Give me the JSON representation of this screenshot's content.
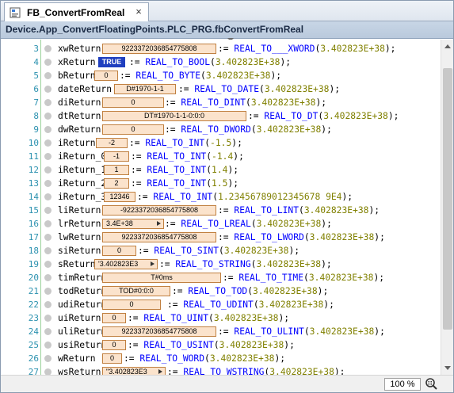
{
  "tab": {
    "label": "FB_ConvertFromReal",
    "close_glyph": "×"
  },
  "header": {
    "title": "Device.App_ConvertFloatingPoints.PLC_PRG.fbConvertFromReal"
  },
  "status": {
    "zoom": "100 %"
  },
  "colors": {
    "keyword": "#0000ff",
    "literal": "#808000",
    "line_number": "#2b91af",
    "monitor_bg": "#fbe3cc",
    "bool_monitor_bg": "#1f3fbf"
  },
  "rows": [
    {
      "line": "3",
      "var": "xwReturn",
      "value": "9223372036854775808",
      "call": "REAL_TO___XWORD",
      "arg": "3.402823E+38"
    },
    {
      "line": "4",
      "var": "xReturn",
      "value": "TRUE",
      "call": "REAL_TO_BOOL",
      "arg": "3.402823E+38"
    },
    {
      "line": "5",
      "var": "bReturn",
      "value": "0",
      "call": "REAL_TO_BYTE",
      "arg": "3.402823E+38"
    },
    {
      "line": "6",
      "var": "dateReturn",
      "value": "D#1970-1-1",
      "call": "REAL_TO_DATE",
      "arg": "3.402823E+38"
    },
    {
      "line": "7",
      "var": "diReturn",
      "value": "0",
      "call": "REAL_TO_DINT",
      "arg": "3.402823E+38"
    },
    {
      "line": "8",
      "var": "dtReturn",
      "value": "DT#1970-1-1-0:0:0",
      "call": "REAL_TO_DT",
      "arg": "3.402823E+38"
    },
    {
      "line": "9",
      "var": "dwReturn",
      "value": "0",
      "call": "REAL_TO_DWORD",
      "arg": "3.402823E+38"
    },
    {
      "line": "10",
      "var": "iReturn",
      "value": "-2",
      "call": "REAL_TO_INT",
      "arg": "-1.5"
    },
    {
      "line": "11",
      "var": "iReturn_0",
      "value": "-1",
      "call": "REAL_TO_INT",
      "arg": "-1.4"
    },
    {
      "line": "12",
      "var": "iReturn_1",
      "value": "1",
      "call": "REAL_TO_INT",
      "arg": "1.4"
    },
    {
      "line": "13",
      "var": "iReturn_2",
      "value": "2",
      "call": "REAL_TO_INT",
      "arg": "1.5"
    },
    {
      "line": "14",
      "var": "iReturn_3",
      "value": "12346",
      "call": "REAL_TO_INT",
      "arg": "1.23456789012345678 9E4"
    },
    {
      "line": "15",
      "var": "liReturn",
      "value": "-9223372036854775808",
      "call": "REAL_TO_LINT",
      "arg": "3.402823E+38"
    },
    {
      "line": "16",
      "var": "lrReturn",
      "value": "3.4E+38",
      "call": "REAL_TO_LREAL",
      "arg": "3.402823E+38"
    },
    {
      "line": "17",
      "var": "lwReturn",
      "value": "9223372036854775808",
      "call": "REAL_TO_LWORD",
      "arg": "3.402823E+38"
    },
    {
      "line": "18",
      "var": "siReturn",
      "value": "0",
      "call": "REAL_TO_SINT",
      "arg": "3.402823E+38"
    },
    {
      "line": "19",
      "var": "sReturn",
      "value": "'3.402823E3",
      "call": "REAL_TO_STRING",
      "arg": "3.402823E+38"
    },
    {
      "line": "20",
      "var": "timReturn",
      "value": "T#0ms",
      "call": "REAL_TO_TIME",
      "arg": "3.402823E+38"
    },
    {
      "line": "21",
      "var": "todReturn",
      "value": "TOD#0:0:0",
      "call": "REAL_TO_TOD",
      "arg": "3.402823E+38"
    },
    {
      "line": "22",
      "var": "udiReturn",
      "value": "0",
      "call": "REAL_TO_UDINT",
      "arg": "3.402823E+38"
    },
    {
      "line": "23",
      "var": "uiReturn",
      "value": "0",
      "call": "REAL_TO_UINT",
      "arg": "3.402823E+38"
    },
    {
      "line": "24",
      "var": "uliReturn",
      "value": "9223372036854775808",
      "call": "REAL_TO_ULINT",
      "arg": "3.402823E+38"
    },
    {
      "line": "25",
      "var": "usiReturn",
      "value": "0",
      "call": "REAL_TO_USINT",
      "arg": "3.402823E+38"
    },
    {
      "line": "26",
      "var": "wReturn",
      "value": "0",
      "call": "REAL_TO_WORD",
      "arg": "3.402823E+38"
    },
    {
      "line": "27",
      "var": "wsReturn",
      "value": "\"3.402823E3",
      "call": "REAL_TO_WSTRING",
      "arg": "3.402823E+38"
    },
    {
      "line": "28",
      "var": "",
      "value": "",
      "call": "",
      "arg": ""
    }
  ]
}
